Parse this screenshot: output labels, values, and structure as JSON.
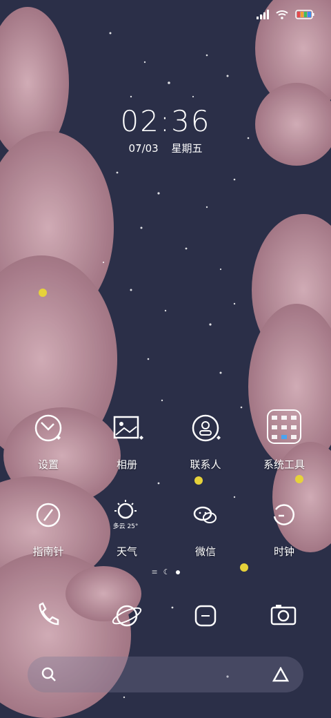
{
  "status": {
    "signal_icon": "signal-icon",
    "wifi_icon": "wifi-icon",
    "battery_icon": "battery-icon"
  },
  "lock": {
    "time": "02:36",
    "date": "07/03",
    "weekday": "星期五"
  },
  "apps": [
    {
      "label": "设置",
      "icon": "wrench-icon"
    },
    {
      "label": "相册",
      "icon": "gallery-icon"
    },
    {
      "label": "联系人",
      "icon": "contact-icon"
    },
    {
      "label": "系统工具",
      "icon": "folder-icon"
    },
    {
      "label": "指南针",
      "icon": "compass-icon"
    },
    {
      "label": "天气",
      "icon": "weather-icon",
      "weather_text": "多云 25°"
    },
    {
      "label": "微信",
      "icon": "wechat-icon"
    },
    {
      "label": "时钟",
      "icon": "clock-icon"
    }
  ],
  "dock": [
    {
      "icon": "phone-icon"
    },
    {
      "icon": "browser-icon"
    },
    {
      "icon": "messages-icon"
    },
    {
      "icon": "camera-icon"
    }
  ],
  "search": {
    "left_icon": "search-icon",
    "right_icon": "assistant-icon"
  },
  "colors": {
    "sky": "#2b2f48",
    "cloud": "#c79aa6",
    "star_yellow": "#e6d23a"
  }
}
